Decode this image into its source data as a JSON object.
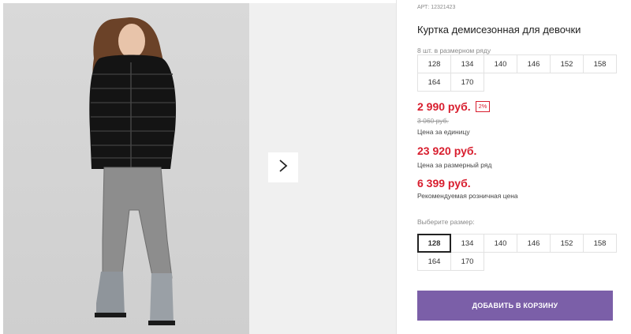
{
  "product": {
    "article": "АРТ: 12321423",
    "title": "Куртка демисезонная для девочки",
    "pack_label": "8 шт. в размерном ряду",
    "pack_sizes": [
      "128",
      "134",
      "140",
      "146",
      "152",
      "158",
      "164",
      "170"
    ],
    "price": "2 990 руб.",
    "discount": "2%",
    "old_price": "3 060 руб.",
    "unit_price_label": "Цена за единицу",
    "row_price": "23 920 руб.",
    "row_price_label": "Цена за размерный ряд",
    "rrp": "6 399 руб.",
    "rrp_label": "Рекомендуемая розничная цена",
    "choose_size_label": "Выберите размер:",
    "sizes": [
      "128",
      "134",
      "140",
      "146",
      "152",
      "158",
      "164",
      "170"
    ],
    "selected_size": "128",
    "add_to_cart": "ДОБАВИТЬ В КОРЗИНУ"
  },
  "gallery": {
    "next_icon": "chevron-right-icon"
  },
  "colors": {
    "price_red": "#d81e2e",
    "cart_button": "#7b5fa8"
  }
}
